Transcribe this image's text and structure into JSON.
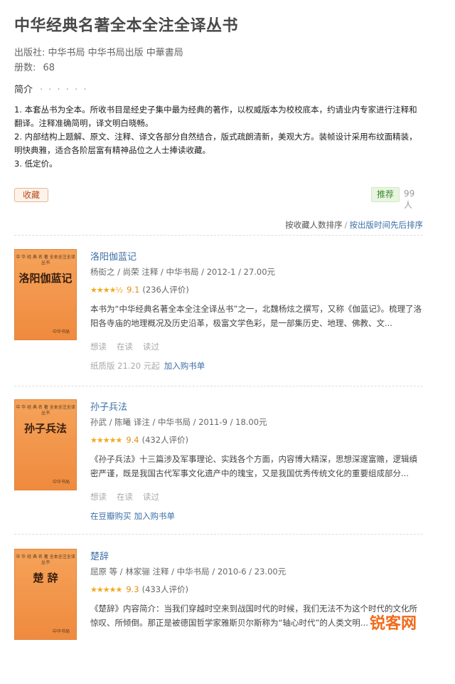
{
  "page": {
    "title": "中华经典名著全本全注全译丛书",
    "publisher_label": "出版社:",
    "publisher_value": "中华书局 中华书局出版 中華書局",
    "volumes_label": "册数:",
    "volumes_value": "68"
  },
  "intro": {
    "heading": "简介",
    "dots": "· · · · · ·",
    "lines": [
      "1. 本套丛书为全本。所收书目是经史子集中最为经典的著作，以权威版本为校校底本，约请业内专家进行注释和",
      "翻译。注释准确简明，译文明白晓畅。",
      "2. 内部结构上题解、原文、注释、译文各部分自然结合，版式疏朗清新，美观大方。装帧设计采用布纹面精装，",
      "明快典雅，适合各阶层富有精神品位之人士捧读收藏。",
      "3. 低定价。"
    ]
  },
  "actions": {
    "collect_label": "收藏",
    "recommend_label": "推荐",
    "recommend_count": "99人"
  },
  "sort": {
    "by_collect": "按收藏人数排序",
    "sep": "/",
    "by_date": "按出版时间先后排序"
  },
  "books": [
    {
      "cover_small": "中 华 经 典 名 著 全本全注全译丛书",
      "cover_title": "洛阳伽蓝记",
      "cover_pub": "中华书局",
      "title": "洛阳伽蓝记",
      "author": "杨衒之 / 尚荣 注释 / 中华书局 / 2012-1 / 27.00元",
      "stars": "★★★★½",
      "score": "9.1",
      "votes": "(236人评价)",
      "desc": "本书为“中华经典名著全本全注全译丛书”之一，北魏杨炫之撰写，又称《伽蓝记》。梳理了洛阳各寺庙的地理概况及历史沿革，极富文学色彩，是一部集历史、地理、佛教、文...",
      "want": "想读",
      "reading": "在读",
      "read": "读过",
      "paper": "纸质版 21.20 元起",
      "link1": "",
      "link2": "加入购书单"
    },
    {
      "cover_small": "中 华 经 典 名 著 全本全注全译丛书",
      "cover_title": "孙子兵法",
      "cover_pub": "中华书局",
      "title": "孙子兵法",
      "author": "孙武 / 陈曦 译注 / 中华书局 / 2011-9 / 18.00元",
      "stars": "★★★★★",
      "score": "9.4",
      "votes": "(432人评价)",
      "desc": "《孙子兵法》十三篇涉及军事理论、实践各个方面，内容博大精深，思想深邃富赡，逻辑缜密严谨，既是我国古代军事文化遗产中的瑰宝，又是我国优秀传统文化的重要组成部分...",
      "want": "想读",
      "reading": "在读",
      "read": "读过",
      "paper": "",
      "link1": "在豆瓣购买",
      "link2": "加入购书单"
    },
    {
      "cover_small": "中 华 经 典 名 著 全本全注全译丛书",
      "cover_title": "楚 辞",
      "cover_pub": "中华书局",
      "title": "楚辞",
      "author": "屈原 等 / 林家骊 注释 / 中华书局 / 2010-6 / 23.00元",
      "stars": "★★★★★",
      "score": "9.3",
      "votes": "(433人评价)",
      "desc": "《楚辞》内容简介：当我们穿越时空来到战国时代的时候，我们无法不为这个时代的文化所惊叹、所倾倒。那正是被德国哲学家雅斯贝尔斯称为“轴心时代”的人类文明...",
      "want": "",
      "reading": "",
      "read": "",
      "paper": "",
      "link1": "",
      "link2": ""
    }
  ],
  "watermark": "锐客网"
}
